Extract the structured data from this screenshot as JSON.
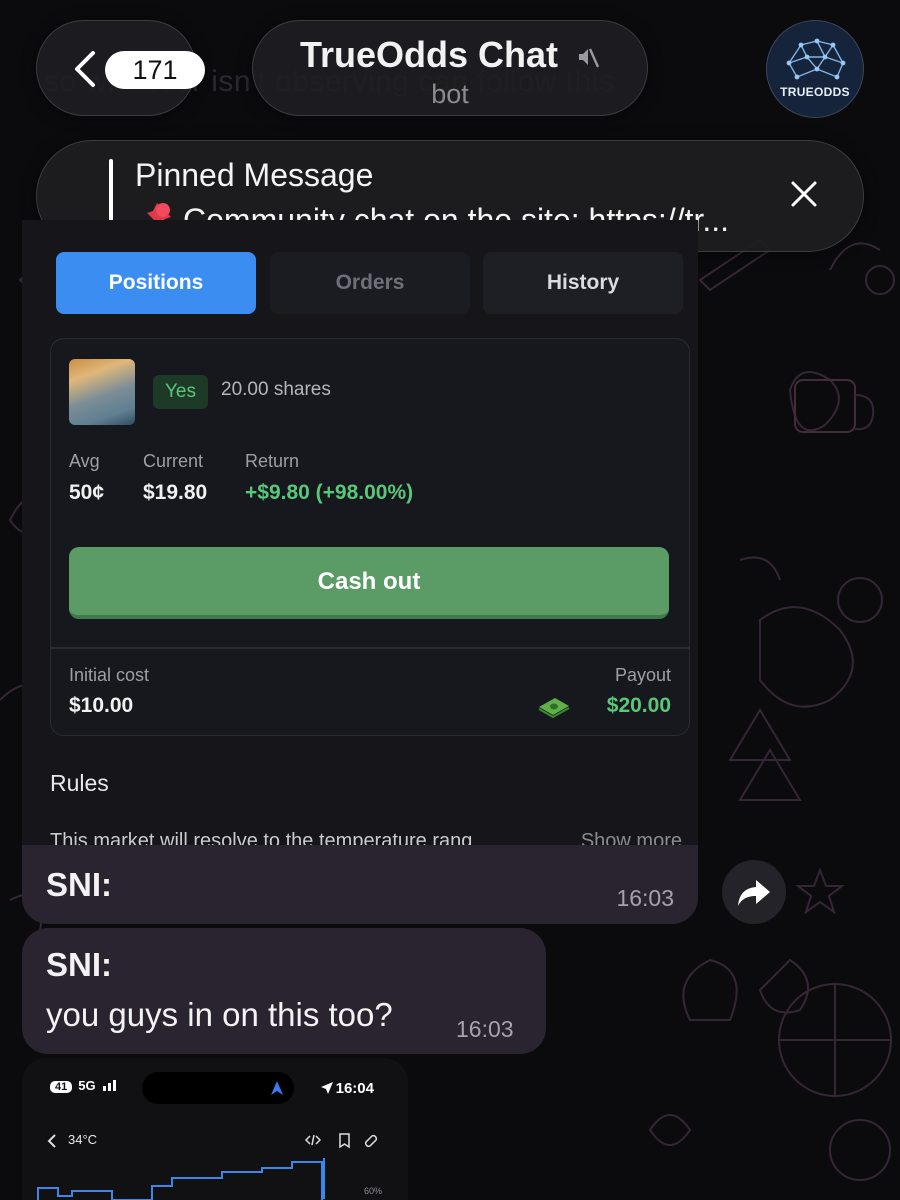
{
  "header": {
    "back_count": "171",
    "title": "TrueOdds Chat",
    "subtitle": "bot",
    "avatar_label": "TRUEODDS"
  },
  "ghost_text": "so whoever isn't observing can follow this",
  "pinned": {
    "title": "Pinned Message",
    "text": "Community chat on the site: https://tr..."
  },
  "screenshot_message": {
    "tabs": [
      {
        "label": "Positions",
        "state": "active"
      },
      {
        "label": "Orders",
        "state": "muted"
      },
      {
        "label": "History",
        "state": "normal"
      }
    ],
    "position": {
      "side": "Yes",
      "shares": "20.00 shares",
      "avg_label": "Avg",
      "avg_value": "50¢",
      "current_label": "Current",
      "current_value": "$19.80",
      "return_label": "Return",
      "return_value": "+$9.80 (+98.00%)",
      "cashout_label": "Cash out",
      "initial_cost_label": "Initial cost",
      "initial_cost_value": "$10.00",
      "payout_label": "Payout",
      "payout_value": "$20.00"
    },
    "rules_heading": "Rules",
    "rules_text": "This market will resolve to the temperature rang",
    "show_more": "Show more",
    "sender": "SNI:",
    "time": "16:03"
  },
  "text_message": {
    "sender": "SNI:",
    "body": "you guys in on this too?",
    "time": "16:03"
  },
  "phone_screenshot": {
    "battery": "41",
    "network": "5G",
    "time": "16:04",
    "temperature": "34°C",
    "percent_label": "60%"
  },
  "colors": {
    "accent_blue": "#3b8df2",
    "green": "#58c77a",
    "cashout_green": "#5a9b66",
    "bubble": "#2a2430"
  }
}
